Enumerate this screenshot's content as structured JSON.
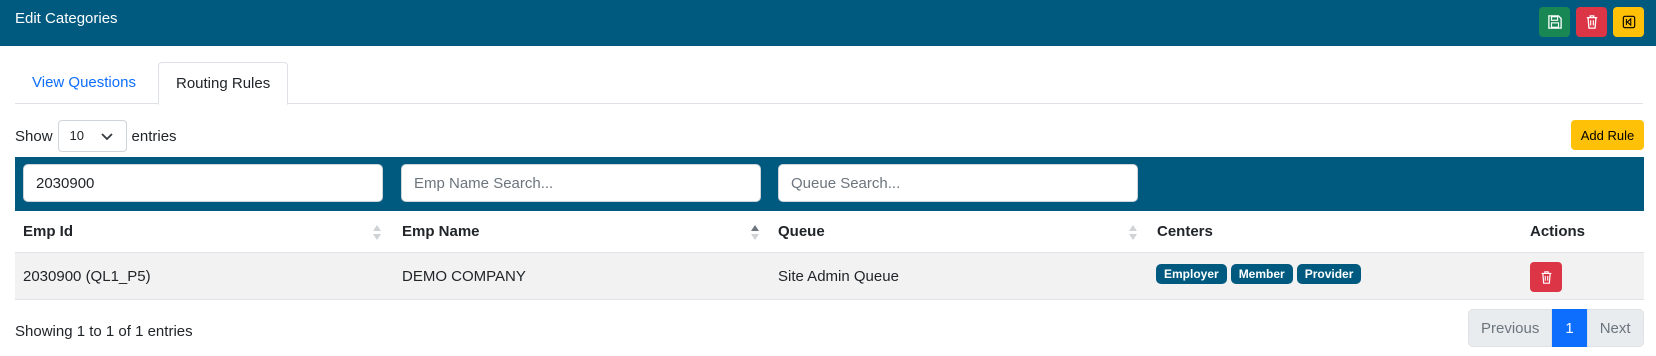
{
  "header": {
    "title": "Edit Categories",
    "buttons": [
      {
        "name": "save",
        "icon": "floppy-icon",
        "color": "#198754"
      },
      {
        "name": "delete",
        "icon": "trash-icon",
        "color": "#dc3545"
      },
      {
        "name": "back",
        "icon": "back-icon",
        "color": "#ffc107"
      }
    ]
  },
  "tabs": [
    {
      "label": "View Questions",
      "active": false
    },
    {
      "label": "Routing Rules",
      "active": true
    }
  ],
  "length": {
    "prefix": "Show",
    "value": "10",
    "suffix": "entries"
  },
  "add_rule_label": "Add Rule",
  "search": {
    "emp_id_value": "2030900",
    "emp_name_placeholder": "Emp Name Search...",
    "queue_placeholder": "Queue Search..."
  },
  "table": {
    "columns": [
      "Emp Id",
      "Emp Name",
      "Queue",
      "Centers",
      "Actions"
    ],
    "sorted_column": "Emp Name",
    "rows": [
      {
        "emp_id": "2030900 (QL1_P5)",
        "emp_name": "DEMO COMPANY",
        "queue": "Site Admin Queue",
        "centers": [
          "Employer",
          "Member",
          "Provider"
        ]
      }
    ]
  },
  "info": "Showing 1 to 1 of 1 entries",
  "pagination": {
    "previous": "Previous",
    "current": "1",
    "next": "Next"
  },
  "colors": {
    "brand": "#005a80",
    "primary": "#0d6efd",
    "warning": "#ffc107",
    "danger": "#dc3545",
    "success": "#198754"
  }
}
